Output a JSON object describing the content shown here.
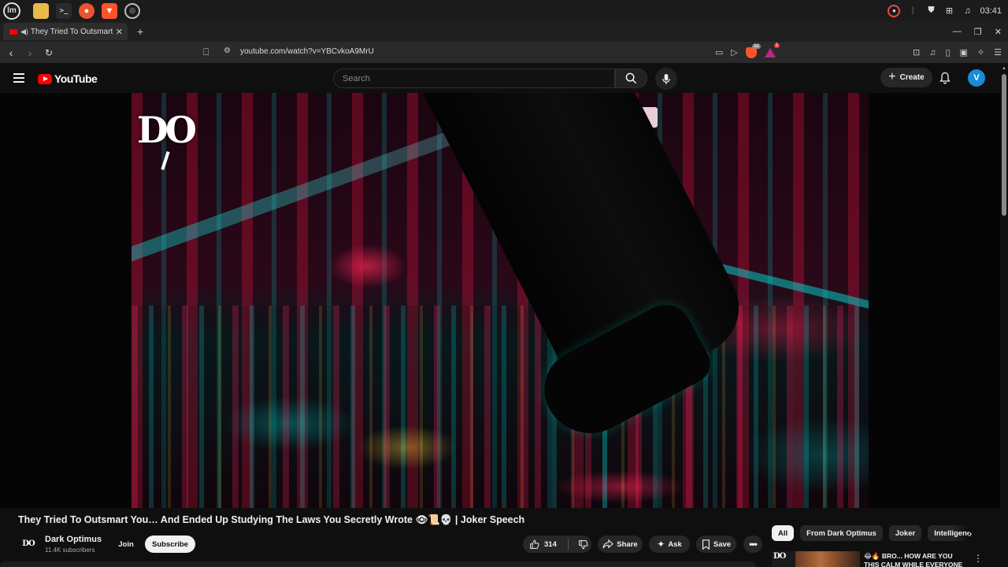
{
  "os": {
    "launcher_label": "lm",
    "apps": [
      "files-icon",
      "terminal-icon",
      "firefox-icon",
      "brave-icon",
      "chromium-icon"
    ],
    "clock": "03:41"
  },
  "browser": {
    "tab_title": "They Tried To Outsmart Yo",
    "new_tab": "+",
    "url": "youtube.com/watch?v=YBCvkoA9MrU",
    "shield_count": "32",
    "rewards_count": "3"
  },
  "youtube": {
    "logo_text": "YouTube",
    "search_placeholder": "Search",
    "create_label": "Create",
    "avatar_letter": "V"
  },
  "video": {
    "watermark": "DO",
    "title": "They Tried To Outsmart You… And Ended Up Studying The Laws You Secretly Wrote 👁📜💀 | Joker Speech",
    "channel": "Dark Optimus",
    "channel_avatar": "DO",
    "subscribers": "11.4K subscribers",
    "join_label": "Join",
    "subscribe_label": "Subscribe",
    "likes": "314",
    "share_label": "Share",
    "ask_label": "Ask",
    "save_label": "Save"
  },
  "sidebar": {
    "chips": [
      "All",
      "From Dark Optimus",
      "Joker",
      "Intelligence"
    ],
    "recommendation": {
      "thumb_logo": "DO",
      "title": "😂🔥 BRO... HOW ARE YOU THIS CALM WHILE EVERYONE"
    }
  },
  "colors": {
    "background": "#0f0f0f",
    "youtube_red": "#ff0000",
    "avatar": "#1a8cd8",
    "subscribe_bg": "#f1f1f1"
  }
}
